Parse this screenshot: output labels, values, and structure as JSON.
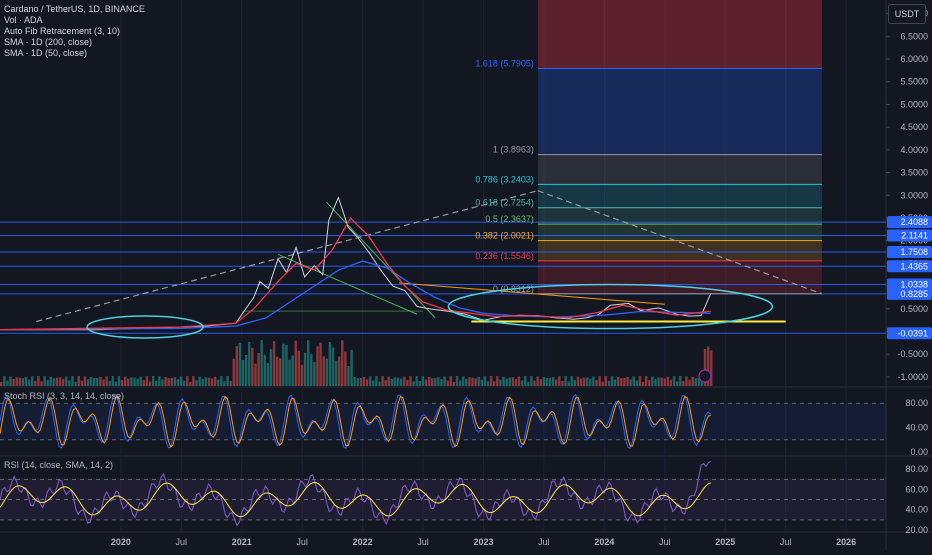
{
  "header": {
    "lines": [
      "Cardano / TetherUS, 1D, BINANCE",
      "Vol · ADA",
      "Auto Fib Retracement (3, 10)",
      "SMA · 1D (200, close)",
      "SMA · 1D (50, close)"
    ],
    "currency": "USDT"
  },
  "panes": {
    "stoch_label": "Stoch RSI (3, 3, 14, 14, close)",
    "rsi_label": "RSI (14, close, SMA, 14, 2)"
  },
  "colors": {
    "background": "#131722",
    "price": "#d1d4dc",
    "sma200": "#2962ff",
    "sma50": "#f23645",
    "volume_up": "#26a69a",
    "volume_down": "#ef5350",
    "stoch_k": "#2962ff",
    "stoch_d": "#ff9800",
    "rsi": "#7e57c2",
    "rsi_sma": "#ffeb3b",
    "ellipse": "#4dd0e1",
    "support": "#ffeb3b"
  },
  "chart_data": [
    {
      "type": "line",
      "pane": "price",
      "x_axis_labels": [
        "2020",
        "Jul",
        "2021",
        "Jul",
        "2022",
        "Jul",
        "2023",
        "Jul",
        "2024",
        "Jul",
        "2025",
        "Jul",
        "2026"
      ],
      "y_axis_labels": [
        "7.0000",
        "6.5000",
        "6.0000",
        "5.5000",
        "5.0000",
        "4.5000",
        "4.0000",
        "3.5000",
        "3.0000",
        "2.5000",
        "2.0000",
        "1.5000",
        "1.0000",
        "0.5000",
        "0.0000",
        "-0.5000",
        "-1.0000"
      ],
      "ylim": [
        -1.2,
        7.3
      ],
      "series": [
        {
          "key": "price",
          "x": [
            2019.0,
            2019.8,
            2020.3,
            2020.7,
            2020.95,
            2021.1,
            2021.15,
            2021.22,
            2021.3,
            2021.37,
            2021.45,
            2021.52,
            2021.6,
            2021.67,
            2021.72,
            2021.8,
            2021.88,
            2021.95,
            2022.05,
            2022.15,
            2022.25,
            2022.35,
            2022.45,
            2022.55,
            2022.7,
            2022.85,
            2023.0,
            2023.15,
            2023.3,
            2023.45,
            2023.6,
            2023.75,
            2023.85,
            2023.95,
            2024.05,
            2024.2,
            2024.3,
            2024.45,
            2024.6,
            2024.7,
            2024.8,
            2024.88
          ],
          "y": [
            0.04,
            0.04,
            0.08,
            0.12,
            0.18,
            0.75,
            1.1,
            0.95,
            1.6,
            1.3,
            1.85,
            1.2,
            1.45,
            1.25,
            2.45,
            2.95,
            2.3,
            2.1,
            1.75,
            1.35,
            1.0,
            0.9,
            0.55,
            0.5,
            0.45,
            0.38,
            0.25,
            0.33,
            0.36,
            0.35,
            0.3,
            0.27,
            0.3,
            0.37,
            0.58,
            0.62,
            0.46,
            0.52,
            0.38,
            0.34,
            0.35,
            0.83
          ]
        },
        {
          "key": "sma200",
          "x": [
            2019.0,
            2020.5,
            2020.95,
            2021.2,
            2021.4,
            2021.6,
            2021.8,
            2022.0,
            2022.2,
            2022.4,
            2022.6,
            2022.8,
            2023.0,
            2023.3,
            2023.6,
            2024.0,
            2024.3,
            2024.6,
            2024.88
          ],
          "y": [
            0.04,
            0.07,
            0.12,
            0.3,
            0.65,
            1.0,
            1.35,
            1.55,
            1.4,
            1.05,
            0.75,
            0.52,
            0.4,
            0.34,
            0.32,
            0.36,
            0.44,
            0.42,
            0.4
          ]
        },
        {
          "key": "sma50",
          "x": [
            2019.0,
            2020.5,
            2020.95,
            2021.1,
            2021.3,
            2021.45,
            2021.6,
            2021.75,
            2021.9,
            2022.05,
            2022.2,
            2022.35,
            2022.5,
            2022.7,
            2022.9,
            2023.1,
            2023.4,
            2023.7,
            2023.95,
            2024.15,
            2024.35,
            2024.6,
            2024.88
          ],
          "y": [
            0.04,
            0.1,
            0.18,
            0.5,
            1.1,
            1.5,
            1.35,
            1.8,
            2.5,
            2.1,
            1.5,
            1.0,
            0.65,
            0.47,
            0.4,
            0.33,
            0.35,
            0.3,
            0.42,
            0.58,
            0.47,
            0.36,
            0.45
          ]
        }
      ],
      "annotations": [
        "1.618 (5.7905)",
        "1 (3.8963)",
        "0.786 (3.2403)",
        "0.618 (2.7254)",
        "0.5 (2.3637)",
        "0.382 (2.0021)",
        "0.236 (1.5546)",
        "0 (0.8312)"
      ],
      "fib_levels": [
        {
          "label": "1.618 (5.7905)",
          "value": 5.7905,
          "color": "#2962ff"
        },
        {
          "label": "1 (3.8963)",
          "value": 3.8963,
          "color": "#9598a1"
        },
        {
          "label": "0.786 (3.2403)",
          "value": 3.2403,
          "color": "#26c6da"
        },
        {
          "label": "0.618 (2.7254)",
          "value": 2.7254,
          "color": "#4db6ac"
        },
        {
          "label": "0.5 (2.3637)",
          "value": 2.3637,
          "color": "#66bb6a"
        },
        {
          "label": "0.382 (2.0021)",
          "value": 2.0021,
          "color": "#ffa726"
        },
        {
          "label": "0.236 (1.5546)",
          "value": 1.5546,
          "color": "#f23645"
        },
        {
          "label": "0 (0.8312)",
          "value": 0.8312,
          "color": "#9598a1"
        }
      ],
      "price_tags": [
        {
          "text": "2.4088",
          "value": 2.4088,
          "color": "#2962ff"
        },
        {
          "text": "2.1141",
          "value": 2.1141,
          "color": "#2962ff"
        },
        {
          "text": "1.7508",
          "value": 1.7508,
          "color": "#2962ff"
        },
        {
          "text": "1.4365",
          "value": 1.4365,
          "color": "#2962ff"
        },
        {
          "text": "1.0338",
          "value": 1.0338,
          "color": "#2962ff"
        },
        {
          "text": "0.8285",
          "value": 0.8285,
          "color": "#2962ff"
        },
        {
          "text": "-0.0391",
          "value": -0.0391,
          "color": "#2962ff"
        }
      ],
      "horizontal_levels": [
        2.4088,
        2.1141,
        1.7508,
        1.4365,
        1.0338,
        0.8285,
        -0.0391
      ]
    },
    {
      "type": "line",
      "pane": "stoch_rsi",
      "y_axis_labels": [
        "80.00",
        "40.00",
        "0.00"
      ],
      "ylim": [
        -5,
        105
      ],
      "levels": [
        80,
        20
      ]
    },
    {
      "type": "line",
      "pane": "rsi",
      "y_axis_labels": [
        "80.00",
        "60.00",
        "40.00",
        "20.00"
      ],
      "ylim": [
        18,
        92
      ],
      "levels": [
        70,
        50,
        30
      ]
    }
  ]
}
